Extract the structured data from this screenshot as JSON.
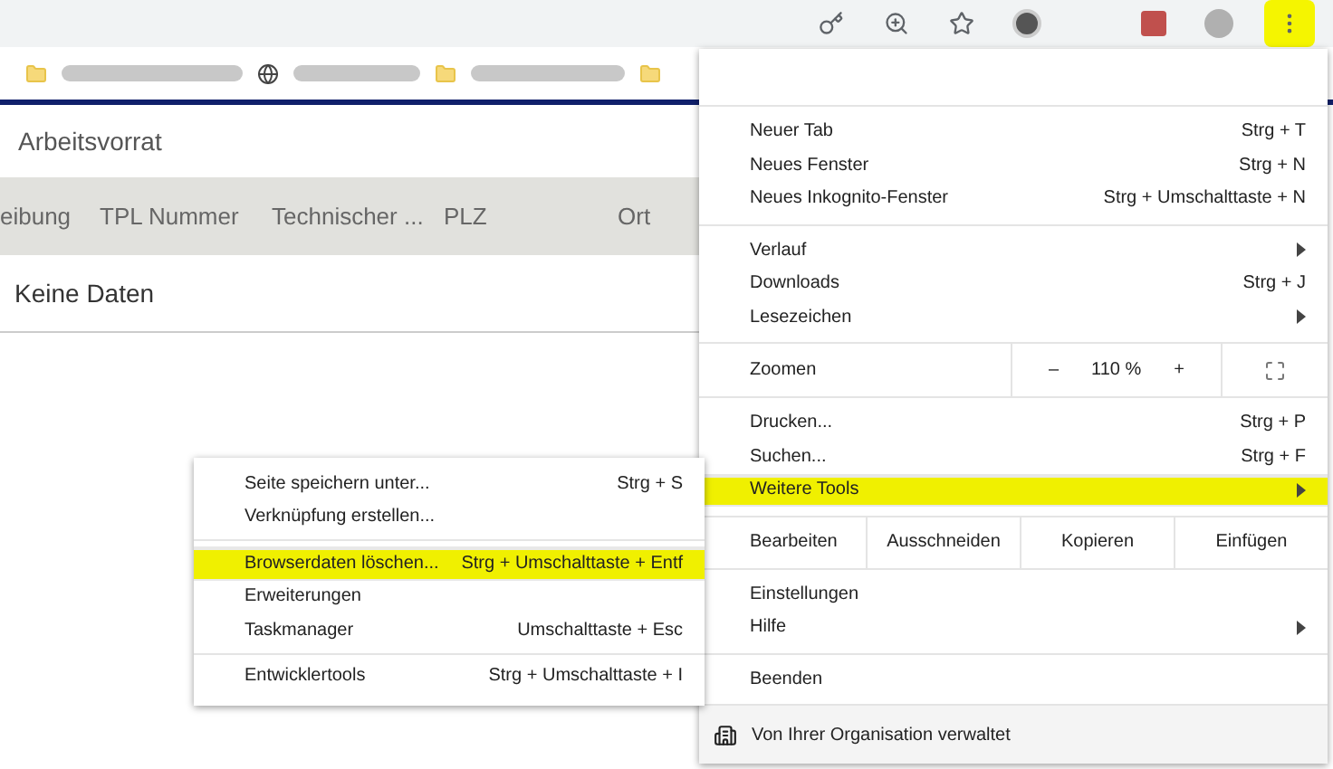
{
  "toolbar": {
    "menu_button": {
      "highlighted": true
    }
  },
  "page": {
    "title": "Arbeitsvorrat",
    "columns": [
      {
        "label": "eibung"
      },
      {
        "label": "TPL Nummer"
      },
      {
        "label": "Technischer ..."
      },
      {
        "label": "PLZ"
      },
      {
        "label": "Ort"
      }
    ],
    "empty_text": "Keine Daten"
  },
  "menu": {
    "sections": [
      [
        {
          "kind": "item",
          "label": "Neuer Tab",
          "shortcut": "Strg + T",
          "submenu": false,
          "selected": false
        },
        {
          "kind": "item",
          "label": "Neues Fenster",
          "shortcut": "Strg + N",
          "submenu": false,
          "selected": false
        },
        {
          "kind": "item",
          "label": "Neues Inkognito-Fenster",
          "shortcut": "Strg + Umschalttaste + N",
          "submenu": false,
          "selected": false
        }
      ],
      [
        {
          "kind": "item",
          "label": "Verlauf",
          "submenu": true,
          "selected": false
        },
        {
          "kind": "item",
          "label": "Downloads",
          "shortcut": "Strg + J",
          "submenu": false,
          "selected": false
        },
        {
          "kind": "item",
          "label": "Lesezeichen",
          "submenu": true,
          "selected": false
        }
      ],
      [
        {
          "kind": "zoom",
          "label": "Zoomen",
          "minus": "–",
          "value": "110 %",
          "plus": "+"
        }
      ],
      [
        {
          "kind": "item",
          "label": "Drucken...",
          "shortcut": "Strg + P",
          "submenu": false,
          "selected": false
        },
        {
          "kind": "item",
          "label": "Suchen...",
          "shortcut": "Strg + F",
          "submenu": false,
          "selected": false
        },
        {
          "kind": "item",
          "label": "Weitere Tools",
          "submenu": true,
          "selected": true
        }
      ],
      [
        {
          "kind": "edit",
          "label": "Bearbeiten",
          "buttons": [
            "Ausschneiden",
            "Kopieren",
            "Einfügen"
          ]
        }
      ],
      [
        {
          "kind": "item",
          "label": "Einstellungen",
          "submenu": false,
          "selected": false
        },
        {
          "kind": "item",
          "label": "Hilfe",
          "submenu": true,
          "selected": false
        }
      ],
      [
        {
          "kind": "item",
          "label": "Beenden",
          "submenu": false,
          "selected": false
        }
      ],
      [
        {
          "kind": "footer",
          "label": "Von Ihrer Organisation verwaltet"
        }
      ]
    ]
  },
  "submenu": {
    "sections": [
      [
        {
          "label": "Seite speichern unter...",
          "shortcut": "Strg + S",
          "selected": false
        },
        {
          "label": "Verknüpfung erstellen...",
          "selected": false
        }
      ],
      [
        {
          "label": "Browserdaten löschen...",
          "shortcut": "Strg + Umschalttaste + Entf",
          "selected": true
        },
        {
          "label": "Erweiterungen",
          "selected": false
        },
        {
          "label": "Taskmanager",
          "shortcut": "Umschalttaste + Esc",
          "selected": false
        }
      ],
      [
        {
          "label": "Entwicklertools",
          "shortcut": "Strg + Umschalttaste + I",
          "selected": false
        }
      ]
    ]
  }
}
